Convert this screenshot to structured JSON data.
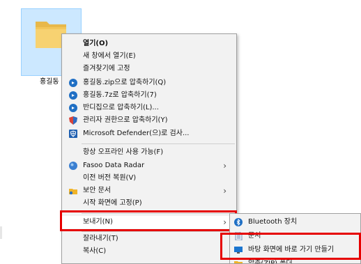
{
  "desktop": {
    "folder_name": "홍길동"
  },
  "context_menu": {
    "items": [
      {
        "label": "열기(O)",
        "bold": true
      },
      {
        "label": "새 창에서 열기(E)"
      },
      {
        "label": "즐겨찾기에 고정"
      },
      {
        "label": "홍길동.zip으로 압축하기(Q)",
        "icon": "bandizip-icon"
      },
      {
        "label": "홍길동.7z로 압축하기(7)",
        "icon": "bandizip-icon"
      },
      {
        "label": "반디집으로 압축하기(L)...",
        "icon": "bandizip-icon"
      },
      {
        "label": "관리자 권한으로 압축하기(Y)",
        "icon": "admin-shield-icon"
      },
      {
        "label": "Microsoft Defender(으)로 검사...",
        "icon": "defender-icon"
      },
      {
        "label": "항상 오프라인 사용 가능(F)"
      },
      {
        "label": "Fasoo Data Radar",
        "icon": "fasoo-icon",
        "submenu": true
      },
      {
        "label": "이전 버전 복원(V)"
      },
      {
        "label": "보안 문서",
        "icon": "security-doc-icon",
        "submenu": true
      },
      {
        "label": "시작 화면에 고정(P)"
      },
      {
        "label": "보내기(N)",
        "submenu": true
      },
      {
        "label": "잘라내기(T)"
      },
      {
        "label": "복사(C)"
      }
    ]
  },
  "send_to_submenu": {
    "items": [
      {
        "label": "Bluetooth 장치",
        "icon": "bluetooth-icon"
      },
      {
        "label": "문서",
        "icon": "documents-icon"
      },
      {
        "label": "바탕 화면에 바로 가기 만들기",
        "icon": "desktop-icon"
      },
      {
        "label": "압축(ZIP) 폴더",
        "icon": "zip-folder-icon"
      }
    ]
  },
  "colors": {
    "highlight_box": "#e60000",
    "selection": "#cce8ff",
    "menu_bg": "#f2f2f2"
  }
}
